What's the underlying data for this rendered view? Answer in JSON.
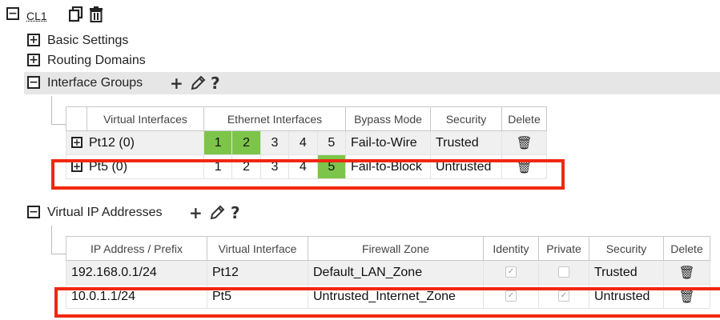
{
  "tree": {
    "root": {
      "toggle": "−",
      "label": "CL1",
      "tools": [
        "copy-icon",
        "trash-icon"
      ]
    },
    "basic_settings": {
      "toggle": "+",
      "label": "Basic Settings"
    },
    "routing_domains": {
      "toggle": "+",
      "label": "Routing Domains"
    },
    "interface_groups": {
      "toggle": "−",
      "label": "Interface Groups",
      "tools": [
        "add-icon",
        "edit-icon",
        "help-icon"
      ],
      "tool_glyphs": {
        "add": "+",
        "help": "?"
      }
    },
    "virtual_ip_addresses": {
      "toggle": "−",
      "label": "Virtual IP Addresses",
      "tools": [
        "add-icon",
        "edit-icon",
        "help-icon"
      ],
      "tool_glyphs": {
        "add": "+",
        "help": "?"
      }
    }
  },
  "interface_groups_table": {
    "headers": [
      "Virtual Interfaces",
      "Ethernet Interfaces",
      "Bypass Mode",
      "Security",
      "Delete"
    ],
    "rows": [
      {
        "expander": "+",
        "name": "Pt12 (0)",
        "ports": [
          "1",
          "2",
          "3",
          "4",
          "5"
        ],
        "active_ports": [
          1,
          2
        ],
        "bypass": "Fail-to-Wire",
        "security": "Trusted",
        "delete_icon": "trash-icon"
      },
      {
        "expander": "+",
        "name": "Pt5 (0)",
        "ports": [
          "1",
          "2",
          "3",
          "4",
          "5"
        ],
        "active_ports": [
          5
        ],
        "bypass": "Fail-to-Block",
        "security": "Untrusted",
        "delete_icon": "trash-icon"
      }
    ]
  },
  "vip_table": {
    "headers": [
      "IP Address / Prefix",
      "Virtual Interface",
      "Firewall Zone",
      "Identity",
      "Private",
      "Security",
      "Delete"
    ],
    "rows": [
      {
        "ip": "192.168.0.1/24",
        "vif": "Pt12",
        "zone": "Default_LAN_Zone",
        "identity": true,
        "private": false,
        "security": "Trusted",
        "delete_icon": "trash-icon"
      },
      {
        "ip": "10.0.1.1/24",
        "vif": "Pt5",
        "zone": "Untrusted_Internet_Zone",
        "identity": true,
        "private": true,
        "security": "Untrusted",
        "delete_icon": "trash-icon"
      }
    ]
  },
  "colors": {
    "active_port": "#7dc54a",
    "highlight": "#f02810",
    "section_bar": "#e6e6e6"
  },
  "glyphs": {
    "trash": "🗑",
    "check": "✓"
  }
}
